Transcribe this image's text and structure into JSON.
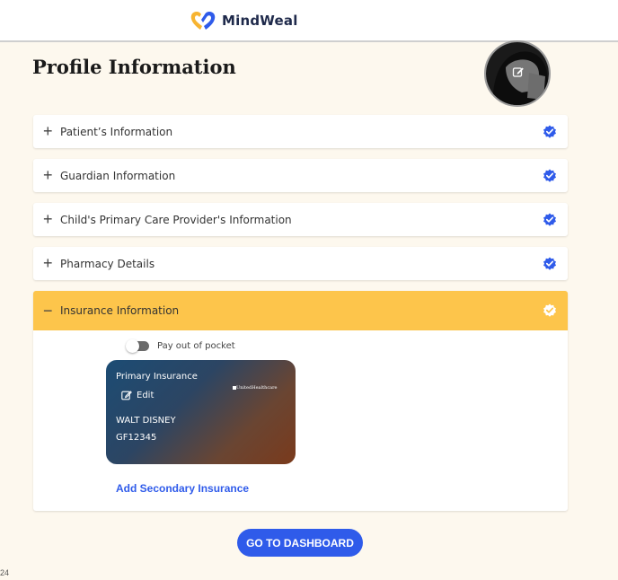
{
  "header": {
    "brand": "MindWeal",
    "logo_colors": {
      "left_heart": "#f7b431",
      "right_heart": "#2f5bea"
    }
  },
  "page": {
    "title": "Profile Information"
  },
  "avatar": {
    "icon": "edit-photo-icon"
  },
  "sections": [
    {
      "label": "Patient’s Information",
      "expanded": false,
      "completed": true
    },
    {
      "label": "Guardian Information",
      "expanded": false,
      "completed": true
    },
    {
      "label": "Child's Primary Care Provider's Information",
      "expanded": false,
      "completed": true
    },
    {
      "label": "Pharmacy Details",
      "expanded": false,
      "completed": true
    },
    {
      "label": "Insurance Information",
      "expanded": true,
      "completed": true
    }
  ],
  "insurance": {
    "pay_out_of_pocket_label": "Pay out of pocket",
    "pay_out_of_pocket_on": false,
    "card": {
      "title": "Primary Insurance",
      "edit_label": "Edit",
      "member_name": "WALT DISNEY",
      "policy_number": "GF12345",
      "insurer_logo": "UnitedHealthcare"
    },
    "add_secondary_label": "Add Secondary Insurance"
  },
  "footer": {
    "dashboard_button": "GO TO DASHBOARD",
    "corner_text": "24"
  },
  "colors": {
    "accent_blue": "#2f5bea",
    "open_section_yellow": "#fdc54b",
    "background_cream": "#fdf8ee"
  }
}
